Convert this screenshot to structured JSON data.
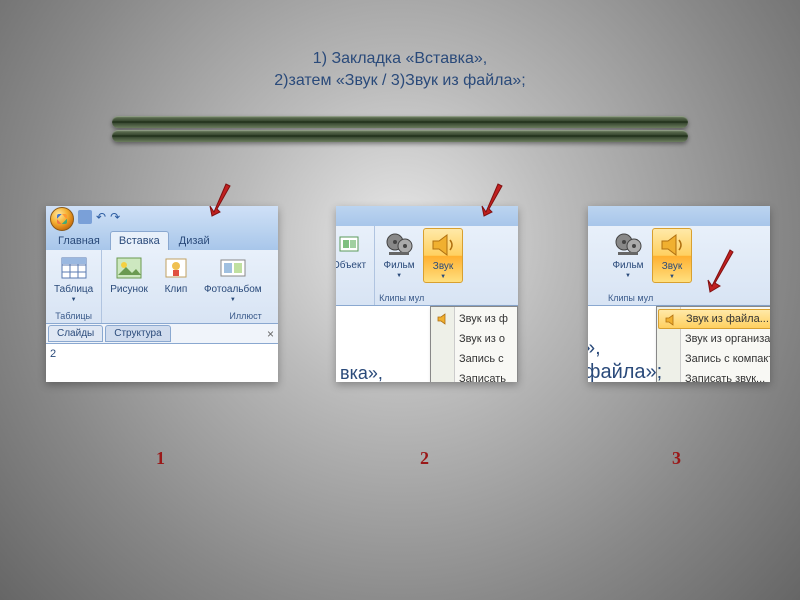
{
  "title_line1": "1) Закладка «Вставка»,",
  "title_line2": "2)затем  «Звук / 3)Звук из файла»;",
  "steps": {
    "s1": "1",
    "s2": "2",
    "s3": "3"
  },
  "shot1": {
    "tabs": {
      "home": "Главная",
      "insert": "Вставка",
      "design": "Дизай"
    },
    "buttons": {
      "table": "Таблица",
      "picture": "Рисунок",
      "clip": "Клип",
      "photoalbum": "Фотоальбом"
    },
    "groups": {
      "tables": "Таблицы",
      "illust": "Иллюст"
    },
    "panes": {
      "slides": "Слайды",
      "structure": "Структура"
    },
    "slide_num": "2"
  },
  "shot2": {
    "buttons": {
      "object": "Объект",
      "film": "Фильм",
      "sound": "Звук"
    },
    "group": "Клипы мул",
    "menu": {
      "m1": "Звук из ф",
      "m2": "Звук из о",
      "m3": "Запись с",
      "m4": "Записать"
    },
    "bottom": "вка»,"
  },
  "shot3": {
    "buttons": {
      "film": "Фильм",
      "sound": "Звук"
    },
    "group": "Клипы мул",
    "menu": {
      "m1": "Звук из файла...",
      "m2": "Звук из организато",
      "m3": "Запись с компакт-д",
      "m4": "Записать звук..."
    },
    "bottom1": "»,",
    "bottom2": "файла»;"
  }
}
